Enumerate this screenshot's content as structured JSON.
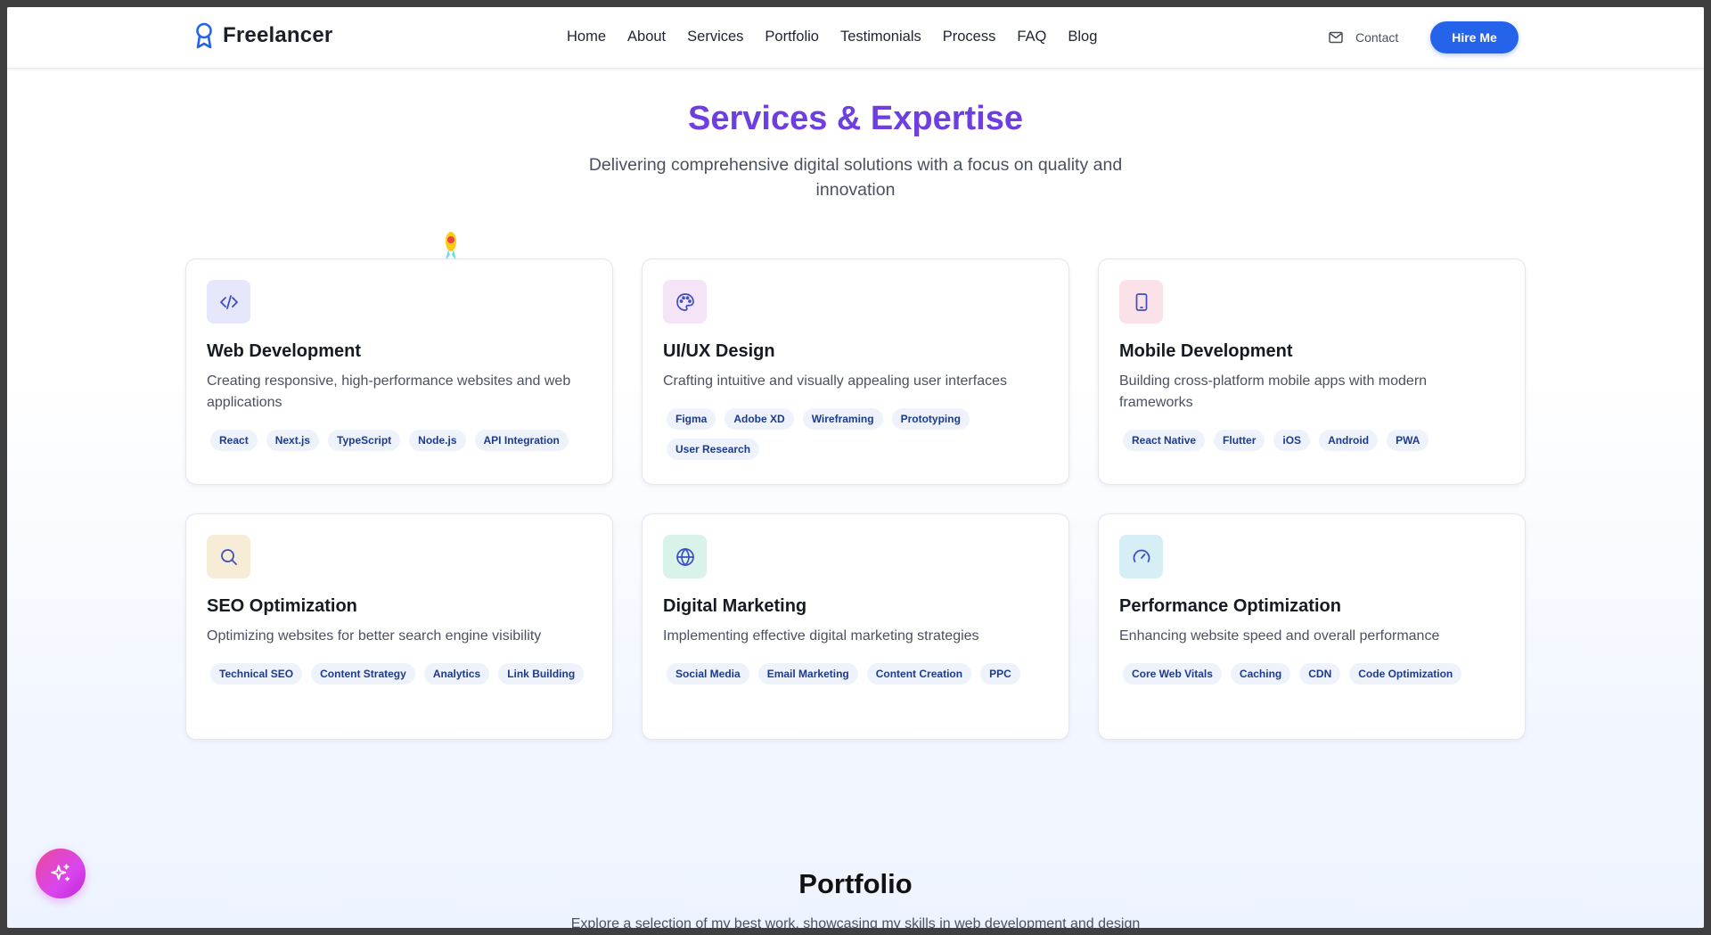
{
  "header": {
    "brand": "Freelancer",
    "nav": [
      "Home",
      "About",
      "Services",
      "Portfolio",
      "Testimonials",
      "Process",
      "FAQ",
      "Blog"
    ],
    "contact_label": "Contact",
    "hire_label": "Hire Me"
  },
  "services": {
    "title": "Services & Expertise",
    "subtitle": "Delivering comprehensive digital solutions with a focus on quality and innovation",
    "cards": [
      {
        "title": "Web Development",
        "desc": "Creating responsive, high-performance websites and web applications",
        "icon": "code-icon",
        "tags": [
          "React",
          "Next.js",
          "TypeScript",
          "Node.js",
          "API Integration"
        ]
      },
      {
        "title": "UI/UX Design",
        "desc": "Crafting intuitive and visually appealing user interfaces",
        "icon": "palette-icon",
        "tags": [
          "Figma",
          "Adobe XD",
          "Wireframing",
          "Prototyping",
          "User Research"
        ]
      },
      {
        "title": "Mobile Development",
        "desc": "Building cross-platform mobile apps with modern frameworks",
        "icon": "smartphone-icon",
        "tags": [
          "React Native",
          "Flutter",
          "iOS",
          "Android",
          "PWA"
        ]
      },
      {
        "title": "SEO Optimization",
        "desc": "Optimizing websites for better search engine visibility",
        "icon": "search-icon",
        "tags": [
          "Technical SEO",
          "Content Strategy",
          "Analytics",
          "Link Building"
        ]
      },
      {
        "title": "Digital Marketing",
        "desc": "Implementing effective digital marketing strategies",
        "icon": "globe-icon",
        "tags": [
          "Social Media",
          "Email Marketing",
          "Content Creation",
          "PPC"
        ]
      },
      {
        "title": "Performance Optimization",
        "desc": "Enhancing website speed and overall performance",
        "icon": "gauge-icon",
        "tags": [
          "Core Web Vitals",
          "Caching",
          "CDN",
          "Code Optimization"
        ]
      }
    ]
  },
  "portfolio": {
    "title": "Portfolio",
    "subtitle": "Explore a selection of my best work, showcasing my skills in web development and design"
  },
  "colors": {
    "accent": "#2563eb",
    "heading_purple": "#6d3fe0",
    "tag_bg": "#eef3fb",
    "tag_text": "#1e3a8a"
  }
}
